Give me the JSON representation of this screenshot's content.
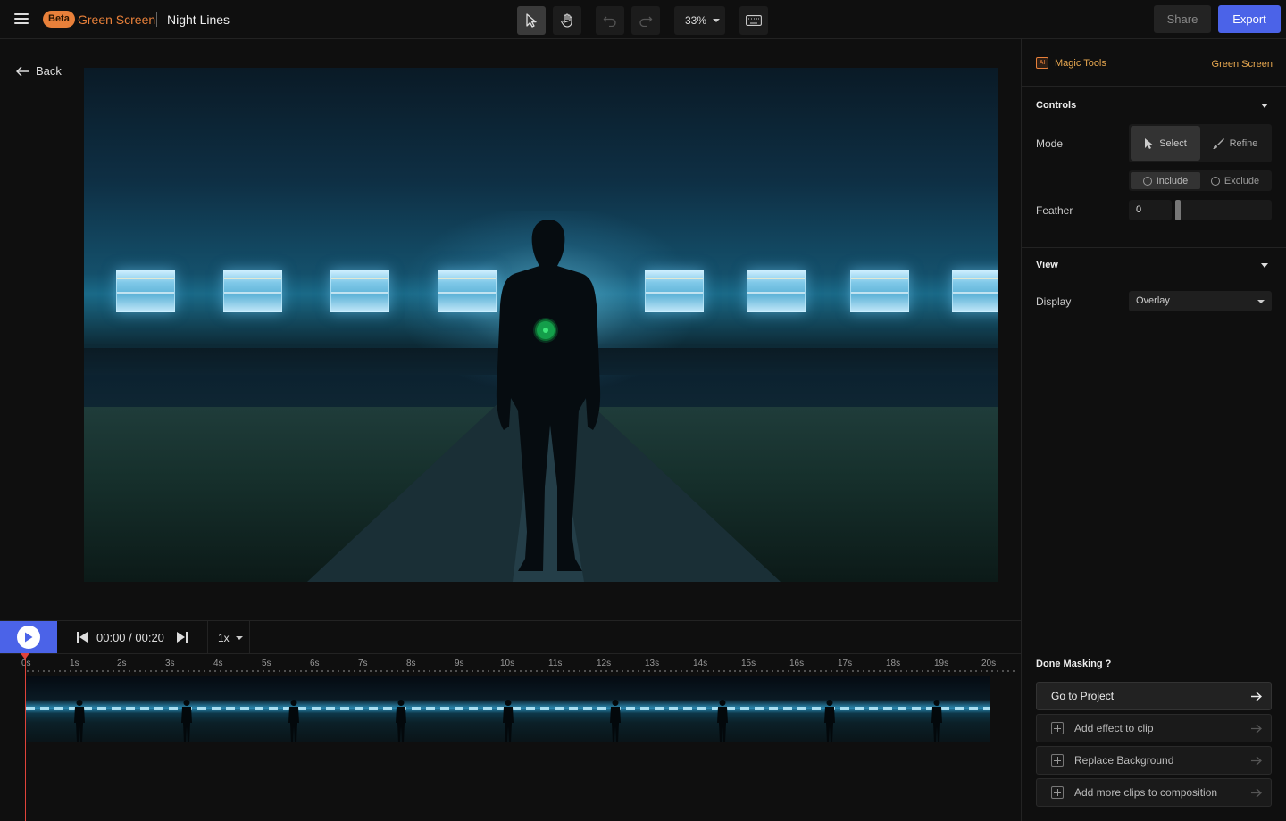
{
  "header": {
    "beta_badge": "Beta",
    "app_name": "Green Screen",
    "project_title": "Night Lines",
    "zoom": "33%",
    "share_label": "Share",
    "export_label": "Export"
  },
  "editor": {
    "back_label": "Back"
  },
  "transport": {
    "time": "00:00 / 00:20",
    "speed": "1x"
  },
  "timeline": {
    "ticks": [
      "0s",
      "1s",
      "2s",
      "3s",
      "4s",
      "5s",
      "6s",
      "7s",
      "8s",
      "9s",
      "10s",
      "11s",
      "12s",
      "13s",
      "14s",
      "15s",
      "16s",
      "17s",
      "18s",
      "19s",
      "20s"
    ]
  },
  "sidebar": {
    "ai_badge": "AI",
    "magic_tools_label": "Magic Tools",
    "green_screen_link": "Green Screen",
    "controls": {
      "title": "Controls",
      "mode_label": "Mode",
      "mode_select": "Select",
      "mode_refine": "Refine",
      "include": "Include",
      "exclude": "Exclude",
      "feather_label": "Feather",
      "feather_value": "0"
    },
    "view": {
      "title": "View",
      "display_label": "Display",
      "display_value": "Overlay"
    },
    "done": {
      "title": "Done Masking ?",
      "go_to_project": "Go to Project",
      "add_effect": "Add effect to clip",
      "replace_background": "Replace Background",
      "add_more_clips": "Add more clips to composition"
    }
  },
  "colors": {
    "accent": "#4b63e8",
    "brand_orange": "#e8803a",
    "playhead": "#e0433a",
    "mask_point": "#149e4a"
  }
}
